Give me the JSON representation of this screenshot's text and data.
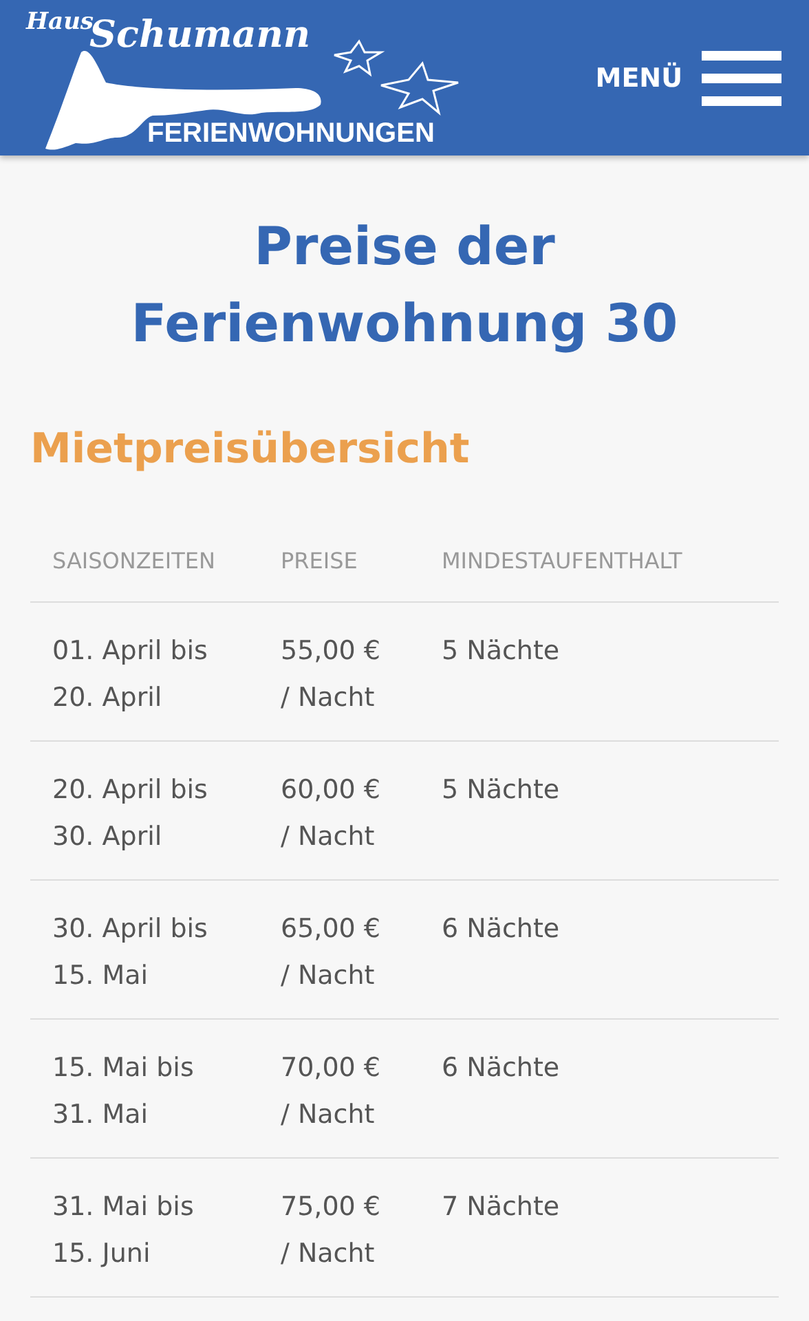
{
  "header": {
    "logo": {
      "line_1": "Haus",
      "line_2": "Schumann",
      "line_3": "FERIENWOHNUNGEN"
    },
    "menu_label": "MENÜ"
  },
  "title": "Preise der Ferienwohnung 30",
  "section_heading": "Mietpreisübersicht",
  "table": {
    "columns": [
      "SAISONZEITEN",
      "PREISE",
      "MINDESTAUFENTHALT"
    ],
    "rows": [
      {
        "season": "01. April bis\n20. April",
        "price": "55,00 €\n/ Nacht",
        "min_stay": "5 Nächte"
      },
      {
        "season": "20. April bis\n30. April",
        "price": "60,00 €\n/ Nacht",
        "min_stay": "5 Nächte"
      },
      {
        "season": "30. April bis\n15. Mai",
        "price": "65,00 €\n/ Nacht",
        "min_stay": "6 Nächte"
      },
      {
        "season": "15. Mai bis\n31. Mai",
        "price": "70,00 €\n/ Nacht",
        "min_stay": "6 Nächte"
      },
      {
        "season": "31. Mai bis\n15. Juni",
        "price": "75,00 €\n/ Nacht",
        "min_stay": "7 Nächte"
      }
    ]
  }
}
